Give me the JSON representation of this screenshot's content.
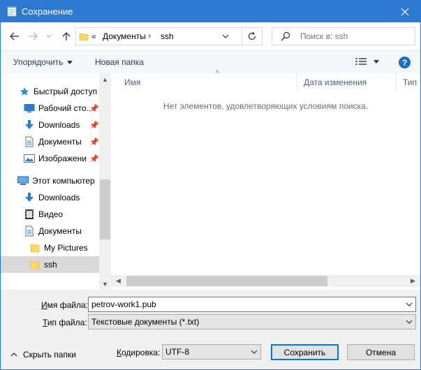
{
  "window": {
    "title": "Сохранение",
    "title_icon": "notepad-icon",
    "close_icon": "close-icon"
  },
  "nav": {
    "back_icon": "arrow-left-icon",
    "forward_icon": "arrow-right-icon",
    "recent_icon": "chevron-down-icon",
    "up_icon": "arrow-up-icon"
  },
  "address": {
    "overflow": "«",
    "segments": [
      "Документы",
      "ssh"
    ],
    "separator": "›",
    "refresh_icon": "refresh-icon"
  },
  "search": {
    "placeholder": "Поиск в: ssh"
  },
  "toolbar": {
    "organize_label": "Упорядочить",
    "new_folder_label": "Новая папка",
    "help_label": "?"
  },
  "sidebar": {
    "items": [
      {
        "label": "Быстрый доступ",
        "icon": "star-icon",
        "pinned": false,
        "indent": 1
      },
      {
        "label": "Рабочий сто...",
        "icon": "desktop-icon",
        "pinned": true,
        "indent": 2
      },
      {
        "label": "Downloads",
        "icon": "download-icon",
        "pinned": true,
        "indent": 2
      },
      {
        "label": "Документы",
        "icon": "document-icon",
        "pinned": true,
        "indent": 2
      },
      {
        "label": "Изображени",
        "icon": "picture-icon",
        "pinned": true,
        "indent": 2
      },
      {
        "label": "Этот компьютер",
        "icon": "computer-icon",
        "pinned": false,
        "indent": 1
      },
      {
        "label": "Downloads",
        "icon": "download-icon",
        "pinned": false,
        "indent": 2
      },
      {
        "label": "Видео",
        "icon": "video-icon",
        "pinned": false,
        "indent": 2
      },
      {
        "label": "Документы",
        "icon": "document-icon",
        "pinned": false,
        "indent": 2
      },
      {
        "label": "My Pictures",
        "icon": "folder-icon",
        "pinned": false,
        "indent": 3
      },
      {
        "label": "ssh",
        "icon": "folder-icon",
        "pinned": false,
        "indent": 3,
        "selected": true
      }
    ]
  },
  "filelist": {
    "columns": [
      "Имя",
      "Дата изменения",
      "Тип"
    ],
    "empty_message": "Нет элементов, удовлетворяющих условиям поиска."
  },
  "form": {
    "filename_label_hot": "И",
    "filename_label_rest": "мя файла:",
    "filename_value": "petrov-work1.pub",
    "filetype_label_hot": "Т",
    "filetype_label_rest": "ип файла:",
    "filetype_value": "Текстовые документы (*.txt)",
    "encoding_label_hot": "К",
    "encoding_label_rest": "одировка:",
    "encoding_value": "UTF-8"
  },
  "footer": {
    "hide_folders_label": "Скрыть папки",
    "save_label": "Сохранить",
    "cancel_label": "Отмена"
  },
  "colors": {
    "titlebar": "#2b79d0",
    "accent": "#0078d7"
  }
}
